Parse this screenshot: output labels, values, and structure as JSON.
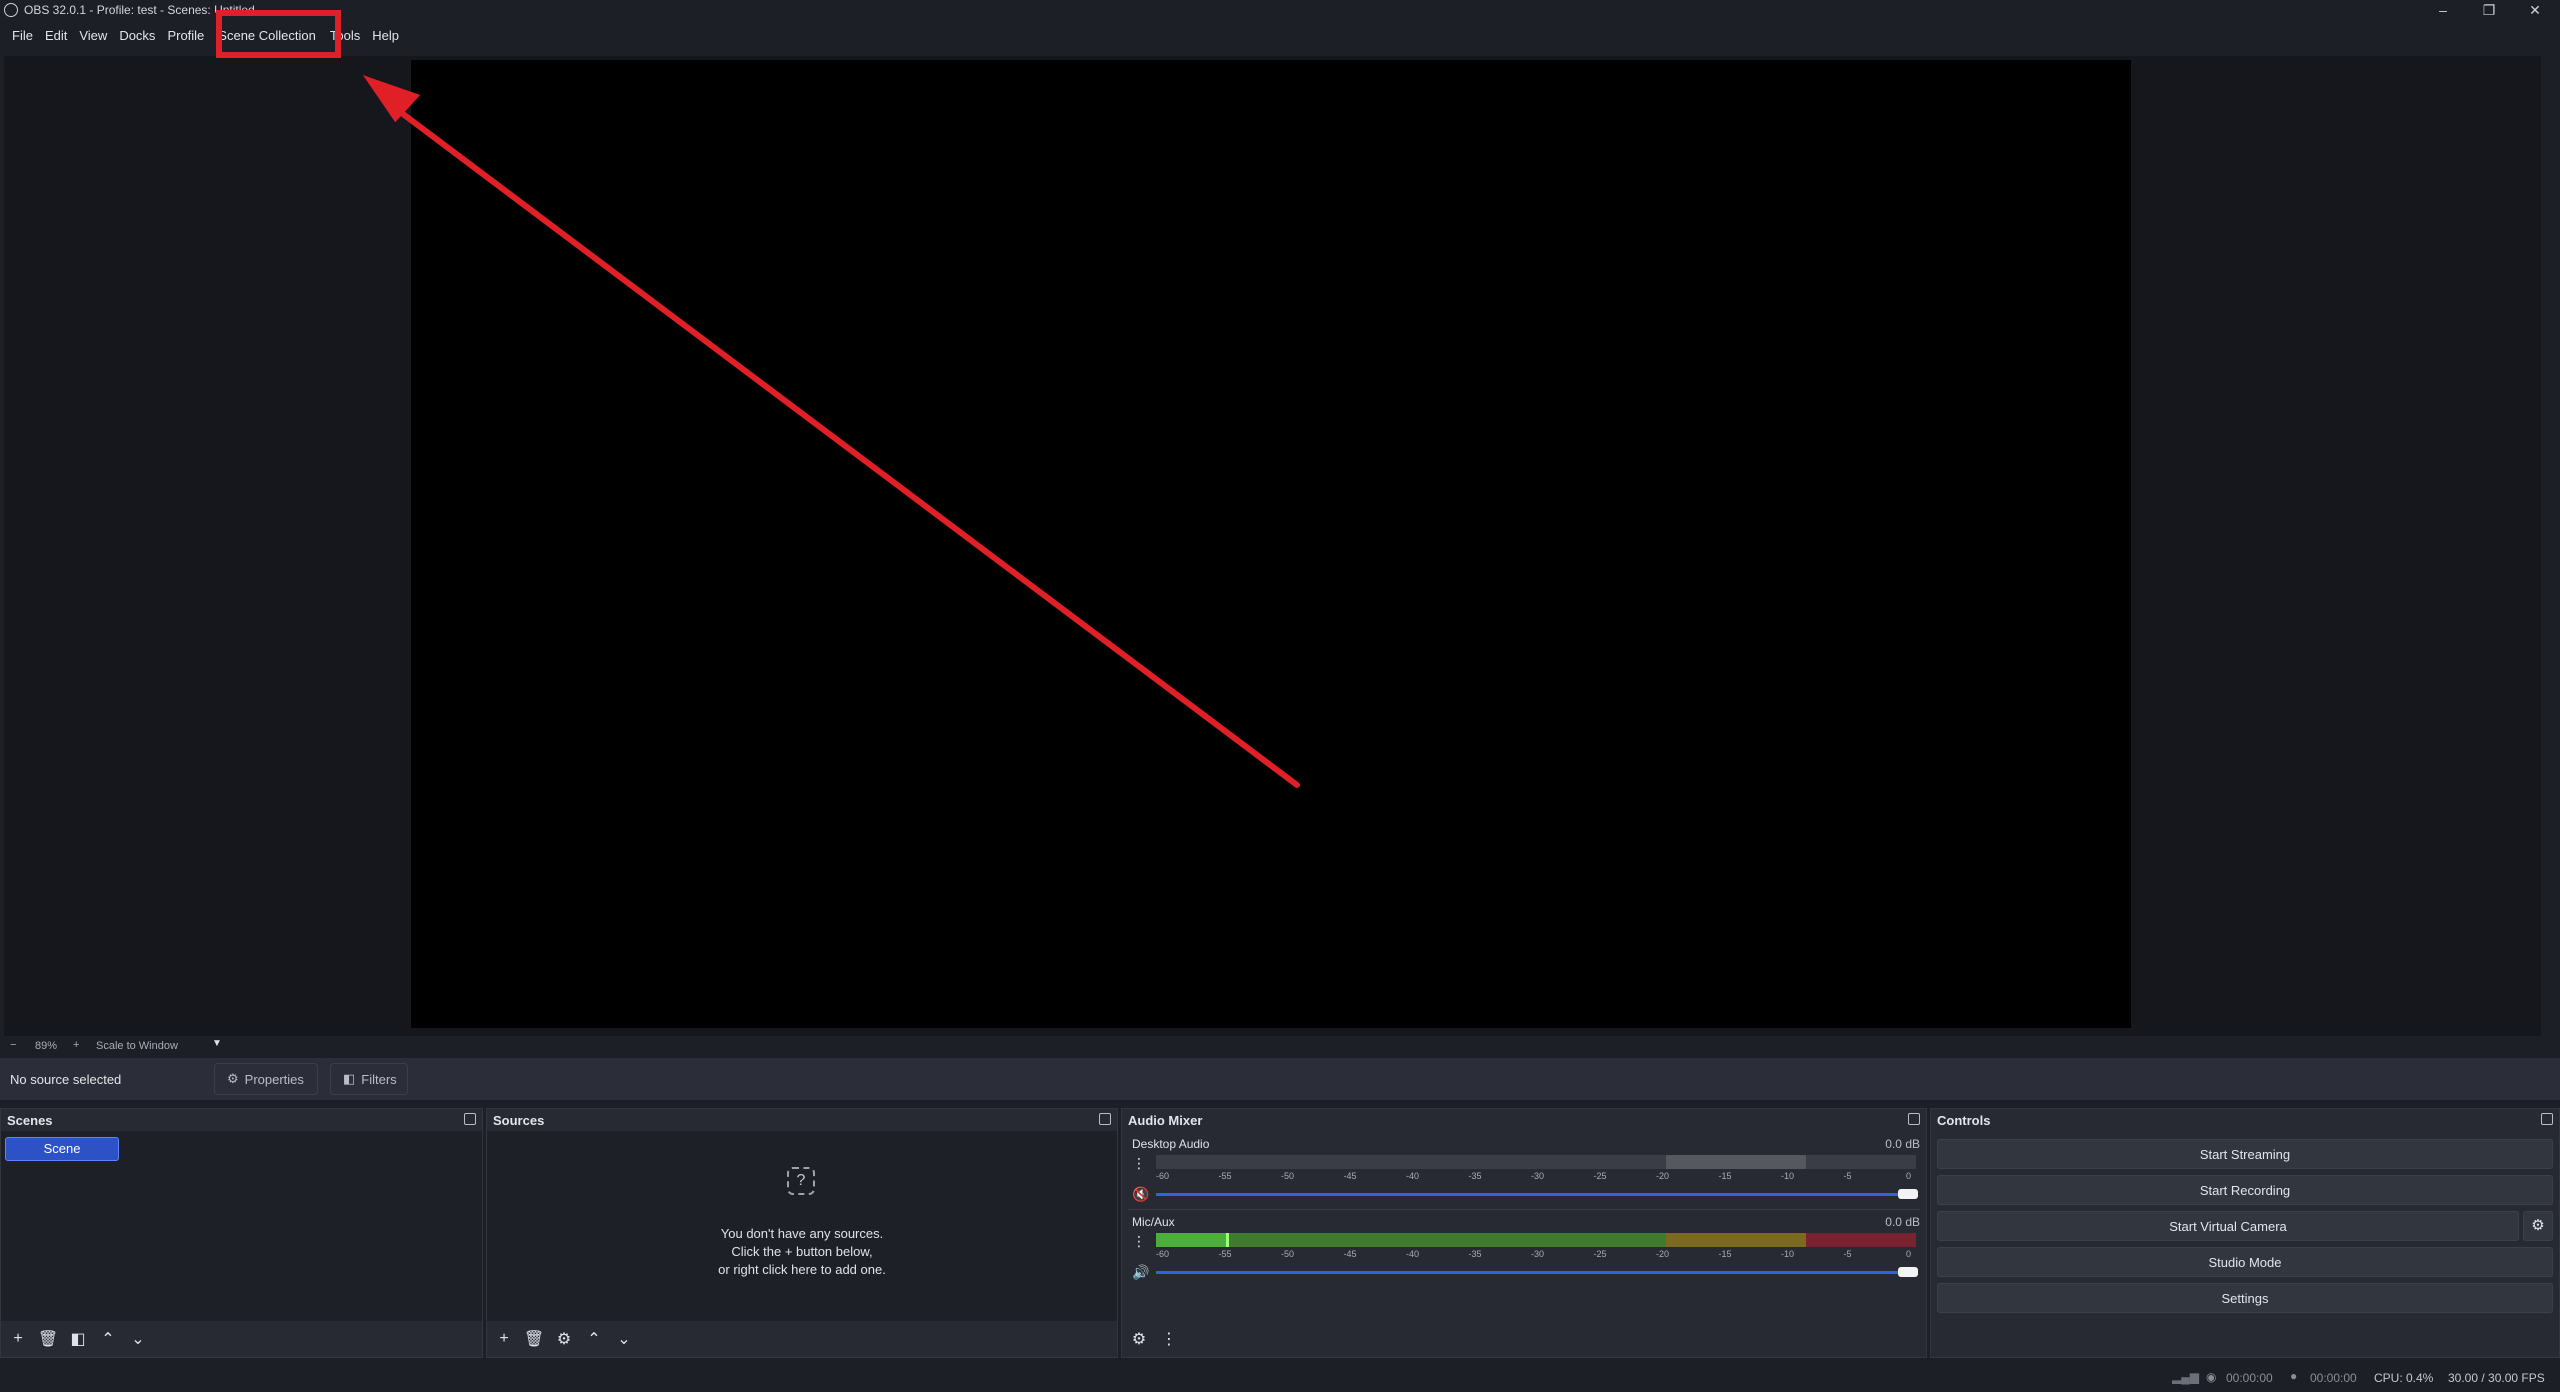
{
  "window": {
    "title": "OBS 32.0.1 - Profile: test - Scenes: Untitled"
  },
  "menu": [
    "File",
    "Edit",
    "View",
    "Docks",
    "Profile",
    "Scene Collection",
    "Tools",
    "Help"
  ],
  "zoom": {
    "minus": "−",
    "value": "89%",
    "plus": "+",
    "mode": "Scale to Window"
  },
  "context": {
    "status": "No source selected",
    "properties": "Properties",
    "filters": "Filters"
  },
  "scenes": {
    "title": "Scenes",
    "items": [
      "Scene"
    ]
  },
  "sources": {
    "title": "Sources",
    "empty_line1": "You don't have any sources.",
    "empty_line2": "Click the + button below,",
    "empty_line3": "or right click here to add one."
  },
  "mixer": {
    "title": "Audio Mixer",
    "channels": [
      {
        "name": "Desktop Audio",
        "db": "0.0 dB",
        "muted": true,
        "level": 0.0
      },
      {
        "name": "Mic/Aux",
        "db": "0.0 dB",
        "muted": false,
        "level": 0.09
      }
    ],
    "ticks": [
      "-60",
      "-55",
      "-50",
      "-45",
      "-40",
      "-35",
      "-30",
      "-25",
      "-20",
      "-15",
      "-10",
      "-5",
      "0"
    ]
  },
  "controls": {
    "title": "Controls",
    "buttons": [
      "Start Streaming",
      "Start Recording",
      "Start Virtual Camera",
      "Studio Mode",
      "Settings"
    ]
  },
  "status": {
    "rec_time": "00:00:00",
    "stream_time": "00:00:00",
    "cpu": "CPU: 0.4%",
    "fps": "30.00 / 30.00 FPS"
  },
  "colors": {
    "highlight": "#e02026",
    "arrow": "#e02026",
    "accent": "#2c52c6"
  }
}
